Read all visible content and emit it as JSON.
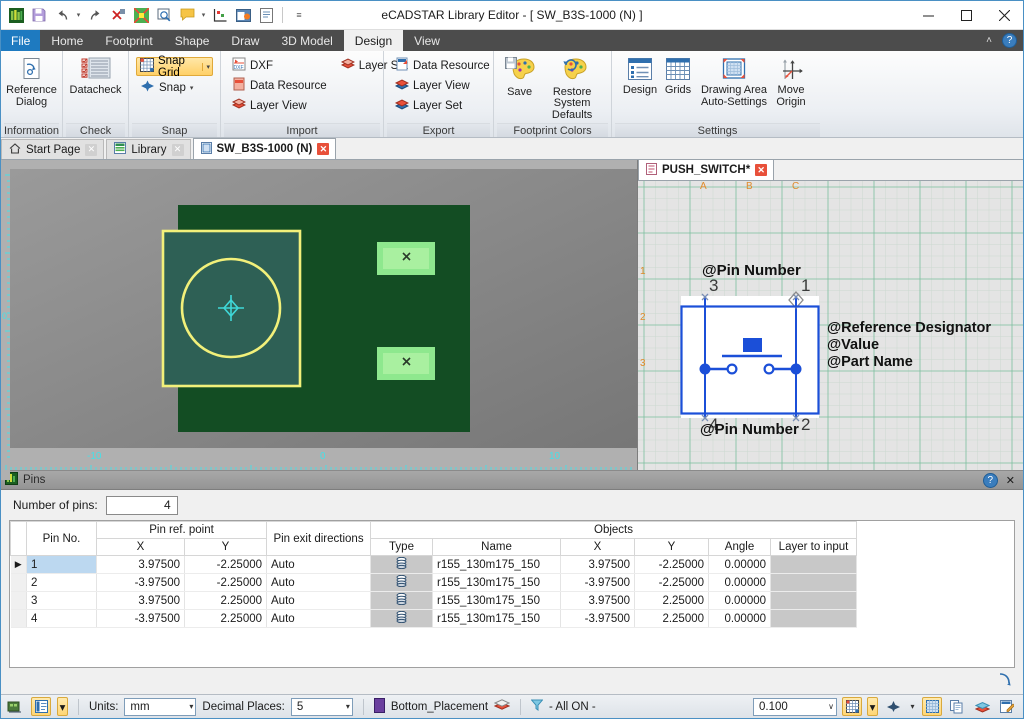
{
  "window": {
    "title": "eCADSTAR Library Editor - [ SW_B3S-1000 (N) ]",
    "minimize": "—",
    "maximize": "❐",
    "close": "✕"
  },
  "quick_access": {
    "items": [
      {
        "name": "app-logo-icon",
        "label": ""
      },
      {
        "name": "save-icon",
        "label": ""
      },
      {
        "name": "undo-icon",
        "label": ""
      },
      {
        "name": "undo-dropdown-caret",
        "label": "▾"
      },
      {
        "name": "redo-icon",
        "label": ""
      },
      {
        "name": "delete-icon",
        "label": ""
      },
      {
        "name": "color-icon",
        "label": ""
      },
      {
        "name": "zoom-icon",
        "label": ""
      },
      {
        "name": "comment-icon",
        "label": ""
      },
      {
        "name": "comment-dropdown-caret",
        "label": "▾"
      },
      {
        "name": "measure-icon",
        "label": ""
      },
      {
        "name": "export-image-icon",
        "label": ""
      },
      {
        "name": "report-icon",
        "label": ""
      },
      {
        "name": "customize-qat-caret",
        "label": "☰"
      }
    ]
  },
  "menu": {
    "file_label": "File",
    "tabs": [
      {
        "label": "Home",
        "active": false
      },
      {
        "label": "Footprint",
        "active": false
      },
      {
        "label": "Shape",
        "active": false
      },
      {
        "label": "Draw",
        "active": false
      },
      {
        "label": "3D Model",
        "active": false
      },
      {
        "label": "Design",
        "active": true
      },
      {
        "label": "View",
        "active": false
      }
    ],
    "collapse_label": "˄",
    "help_label": "?"
  },
  "ribbon": {
    "groups": [
      {
        "name": "information",
        "label": "Information",
        "buttons": [
          {
            "name": "reference-dialog-button",
            "label_line1": "Reference",
            "label_line2": "Dialog",
            "icon": "reference-dialog-icon"
          }
        ]
      },
      {
        "name": "check",
        "label": "Check",
        "buttons": [
          {
            "name": "datacheck-button",
            "label_line1": "Datacheck",
            "label_line2": "",
            "icon": "datacheck-icon"
          }
        ]
      },
      {
        "name": "snap",
        "label": "Snap",
        "snap_grid_label": "Snap Grid",
        "snap_label": "Snap",
        "caret": "▾"
      },
      {
        "name": "import",
        "label": "Import",
        "items": [
          {
            "label": "DXF",
            "icon": "dxf-import-icon"
          },
          {
            "label": "Data Resource",
            "icon": "data-resource-import-icon"
          },
          {
            "label": "Layer View",
            "icon": "layer-view-import-icon"
          },
          {
            "label": "Layer Set",
            "icon": "layer-set-import-icon"
          }
        ]
      },
      {
        "name": "export",
        "label": "Export",
        "items": [
          {
            "label": "Data Resource",
            "icon": "data-resource-export-icon"
          },
          {
            "label": "Layer View",
            "icon": "layer-view-export-icon"
          },
          {
            "label": "Layer Set",
            "icon": "layer-set-export-icon"
          }
        ]
      },
      {
        "name": "footprint-colors",
        "label": "Footprint Colors",
        "buttons": [
          {
            "name": "save-colors-button",
            "label_line1": "Save",
            "label_line2": "",
            "icon": "save-palette-icon"
          },
          {
            "name": "restore-defaults-button",
            "label_line1": "Restore System",
            "label_line2": "Defaults",
            "icon": "restore-palette-icon"
          }
        ]
      },
      {
        "name": "settings",
        "label": "Settings",
        "buttons": [
          {
            "name": "design-settings-button",
            "label_line1": "Design",
            "label_line2": "",
            "icon": "design-settings-icon"
          },
          {
            "name": "grids-settings-button",
            "label_line1": "Grids",
            "label_line2": "",
            "icon": "grids-icon"
          },
          {
            "name": "drawing-area-auto-settings-button",
            "label_line1": "Drawing Area",
            "label_line2": "Auto-Settings",
            "icon": "drawing-area-icon"
          },
          {
            "name": "move-origin-button",
            "label_line1": "Move",
            "label_line2": "Origin",
            "icon": "move-origin-icon"
          }
        ]
      }
    ]
  },
  "document_tabs": [
    {
      "label": "Start Page",
      "active": false,
      "icon": "home-icon",
      "close": "✕"
    },
    {
      "label": "Library",
      "active": false,
      "icon": "library-icon",
      "close": "✕"
    },
    {
      "label": "SW_B3S-1000 (N)",
      "active": true,
      "icon": "footprint-icon",
      "close": "✕"
    }
  ],
  "symbol_tabs": [
    {
      "label": "PUSH_SWITCH*",
      "active": true,
      "icon": "symbol-icon",
      "close": "✕"
    }
  ],
  "footprint_view": {
    "name": "footprint-canvas",
    "ruler_labels_x": [
      "-10",
      "0",
      "10"
    ],
    "ruler_labels_y": [
      "0"
    ],
    "colors": {
      "background": "#134d23",
      "body": "#2e6055",
      "outline": "#f2f07a",
      "pad": "#8ee88e",
      "pad_inner": "#a9f0a0",
      "origin": "#3fd8d8"
    },
    "pads": [
      {
        "name": "pad-top-left",
        "marker": "✕"
      },
      {
        "name": "pad-top-right",
        "marker": "✕"
      },
      {
        "name": "pad-bottom-left",
        "marker": "✕"
      },
      {
        "name": "pad-bottom-right",
        "marker": "✕"
      }
    ]
  },
  "symbol_view": {
    "name": "symbol-canvas",
    "column_labels": [
      "A",
      "B",
      "C"
    ],
    "row_labels": [
      "1",
      "2",
      "3"
    ],
    "top_attribute": "@Pin Number",
    "bottom_attribute": "@Pin Number",
    "pin_numbers": {
      "top_left": "3",
      "top_right": "1",
      "bottom_left": "4",
      "bottom_right": "2"
    },
    "attributes": [
      "@Reference Designator",
      "@Value",
      "@Part Name"
    ],
    "colors": {
      "symbol": "#1b4fd8",
      "grid": "#a8d8c0",
      "label": "#e08a2b",
      "background": "#e4e4e4"
    }
  },
  "pins_panel": {
    "title": "Pins",
    "help_label": "?",
    "close_label": "✕",
    "number_of_pins_label": "Number of pins:",
    "number_of_pins_value": "4",
    "headers": {
      "row_mark": "",
      "pin_no": "Pin No.",
      "pin_ref_point": "Pin ref. point",
      "pin_ref_x": "X",
      "pin_ref_y": "Y",
      "pin_exit_directions": "Pin exit directions",
      "objects": "Objects",
      "type": "Type",
      "name": "Name",
      "obj_x": "X",
      "obj_y": "Y",
      "angle": "Angle",
      "layer_to_input": "Layer to input"
    },
    "rows": [
      {
        "marker": "▶",
        "pin_no": "1",
        "ref_x": "3.97500",
        "ref_y": "-2.25000",
        "exit": "Auto",
        "type_icon": "pad-stack-icon",
        "name": "r155_130m175_150",
        "obj_x": "3.97500",
        "obj_y": "-2.25000",
        "angle": "0.00000",
        "layer": "",
        "selected": true
      },
      {
        "marker": "",
        "pin_no": "2",
        "ref_x": "-3.97500",
        "ref_y": "-2.25000",
        "exit": "Auto",
        "type_icon": "pad-stack-icon",
        "name": "r155_130m175_150",
        "obj_x": "-3.97500",
        "obj_y": "-2.25000",
        "angle": "0.00000",
        "layer": "",
        "selected": false
      },
      {
        "marker": "",
        "pin_no": "3",
        "ref_x": "3.97500",
        "ref_y": "2.25000",
        "exit": "Auto",
        "type_icon": "pad-stack-icon",
        "name": "r155_130m175_150",
        "obj_x": "3.97500",
        "obj_y": "2.25000",
        "angle": "0.00000",
        "layer": "",
        "selected": false
      },
      {
        "marker": "",
        "pin_no": "4",
        "ref_x": "-3.97500",
        "ref_y": "2.25000",
        "exit": "Auto",
        "type_icon": "pad-stack-icon",
        "name": "r155_130m175_150",
        "obj_x": "-3.97500",
        "obj_y": "2.25000",
        "angle": "0.00000",
        "layer": "",
        "selected": false
      }
    ]
  },
  "status_bar": {
    "units_label": "Units:",
    "units_value": "mm",
    "decimal_places_label": "Decimal Places:",
    "decimal_places_value": "5",
    "layer_name": "Bottom_Placement",
    "filter_text": "- All ON -",
    "zoom_value": "0.100",
    "caret": "▾",
    "dropdown_caret": "∨"
  }
}
